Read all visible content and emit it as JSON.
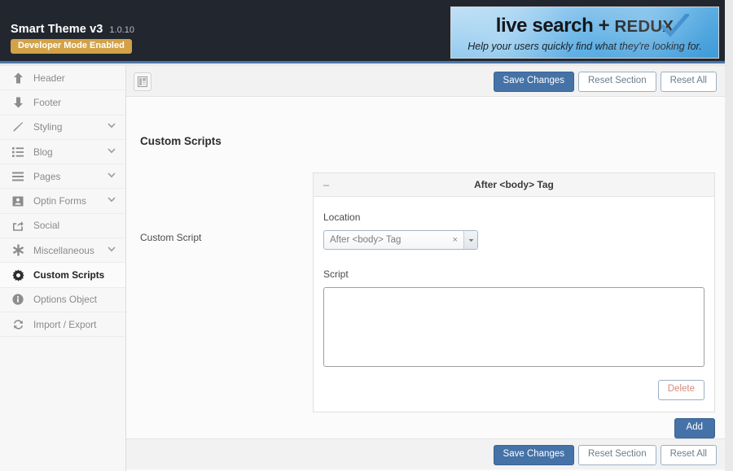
{
  "header": {
    "brand_title": "Smart Theme v3",
    "version": "1.0.10",
    "dev_badge": "Developer Mode Enabled"
  },
  "banner": {
    "line1_main": "live search + ",
    "line1_redux": "REDUX",
    "line2": "Help your users quickly find what they're looking for.",
    "bg_start": "#bcdff5",
    "bg_end": "#3f9ad8"
  },
  "sidebar": {
    "items": [
      {
        "label": "Header",
        "icon": "arrow-up-icon",
        "glyph": "⬆",
        "caret": false,
        "active": false
      },
      {
        "label": "Footer",
        "icon": "arrow-down-icon",
        "glyph": "⬇",
        "caret": false,
        "active": false
      },
      {
        "label": "Styling",
        "icon": "pencil-icon",
        "glyph": "╱",
        "caret": true,
        "active": false
      },
      {
        "label": "Blog",
        "icon": "list-icon",
        "glyph": "☰",
        "caret": true,
        "active": false
      },
      {
        "label": "Pages",
        "icon": "bars-icon",
        "glyph": "☰",
        "caret": true,
        "active": false
      },
      {
        "label": "Optin Forms",
        "icon": "contact-card-icon",
        "glyph": "▣",
        "caret": true,
        "active": false
      },
      {
        "label": "Social",
        "icon": "share-icon",
        "glyph": "↗",
        "caret": false,
        "active": false
      },
      {
        "label": "Miscellaneous",
        "icon": "star-icon",
        "glyph": "✳",
        "caret": true,
        "active": false
      },
      {
        "label": "Custom Scripts",
        "icon": "gear-icon",
        "glyph": "⚙",
        "caret": false,
        "active": true
      },
      {
        "label": "Options Object",
        "icon": "info-icon",
        "glyph": "ℹ",
        "caret": false,
        "active": false
      },
      {
        "label": "Import / Export",
        "icon": "refresh-icon",
        "glyph": "↻",
        "caret": false,
        "active": false
      }
    ]
  },
  "toolbar": {
    "panel_toggle_icon": "layout-panel-icon",
    "save_label": "Save Changes",
    "reset_section_label": "Reset Section",
    "reset_all_label": "Reset All",
    "primary_color": "#4572a7"
  },
  "main": {
    "section_title": "Custom Scripts",
    "field_label": "Custom Script"
  },
  "script_panel": {
    "collapse_icon": "minus-icon",
    "collapse_glyph": "–",
    "title": "After <body> Tag",
    "location_label": "Location",
    "location_value": "After <body> Tag",
    "location_clear_icon": "clear-x-icon",
    "location_clear_glyph": "×",
    "location_arrow_glyph": "▼",
    "script_label": "Script",
    "script_value": "",
    "script_placeholder": "",
    "delete_label": "Delete",
    "delete_color": "#d38b78"
  },
  "footer_actions": {
    "add_label": "Add",
    "save_label": "Save Changes",
    "reset_section_label": "Reset Section",
    "reset_all_label": "Reset All"
  }
}
